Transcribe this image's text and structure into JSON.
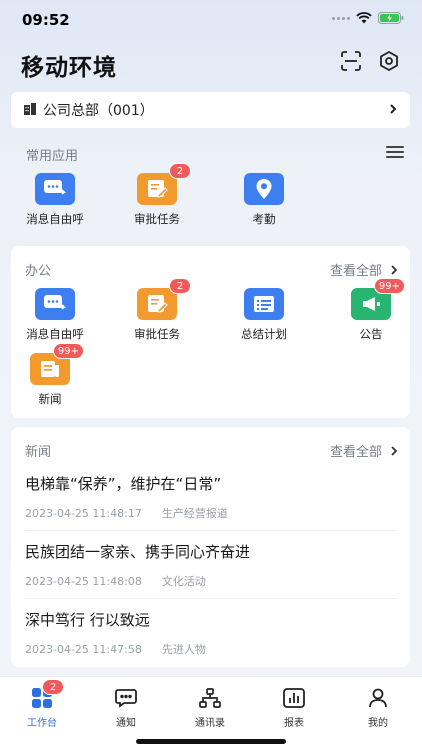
{
  "status": {
    "time": "09:52"
  },
  "header": {
    "title": "移动环境",
    "scan_icon": "scan-icon",
    "settings_icon": "settings-hexagon-icon"
  },
  "company": {
    "label": "公司总部（001）"
  },
  "favorites": {
    "title": "常用应用",
    "apps": [
      {
        "label": "消息自由呼",
        "color": "#3d7ef0",
        "badge": ""
      },
      {
        "label": "审批任务",
        "color": "#f39a2e",
        "badge": "2"
      },
      {
        "label": "考勤",
        "color": "#3d7ef0",
        "badge": ""
      }
    ]
  },
  "office": {
    "title": "办公",
    "view_all": "查看全部",
    "apps": [
      {
        "label": "消息自由呼",
        "color": "#3d7ef0",
        "badge": ""
      },
      {
        "label": "审批任务",
        "color": "#f39a2e",
        "badge": "2"
      },
      {
        "label": "总结计划",
        "color": "#3d7ef0",
        "badge": ""
      },
      {
        "label": "公告",
        "color": "#28b571",
        "badge": "99+"
      },
      {
        "label": "新闻",
        "color": "#f39a2e",
        "badge": "99+"
      }
    ]
  },
  "news": {
    "title": "新闻",
    "view_all": "查看全部",
    "items": [
      {
        "title": "电梯靠“保养”，维护在“日常”",
        "time": "2023-04-25 11:48:17",
        "category": "生产经营报道"
      },
      {
        "title": "民族团结一家亲、携手同心齐奋进",
        "time": "2023-04-25 11:48:08",
        "category": "文化活动"
      },
      {
        "title": "深中笃行 行以致远",
        "time": "2023-04-25 11:47:58",
        "category": "先进人物"
      }
    ]
  },
  "tabbar": {
    "accent": "#2f6fe4",
    "tabs": [
      {
        "label": "工作台",
        "badge": "2"
      },
      {
        "label": "通知"
      },
      {
        "label": "通讯录"
      },
      {
        "label": "报表"
      },
      {
        "label": "我的"
      }
    ]
  }
}
